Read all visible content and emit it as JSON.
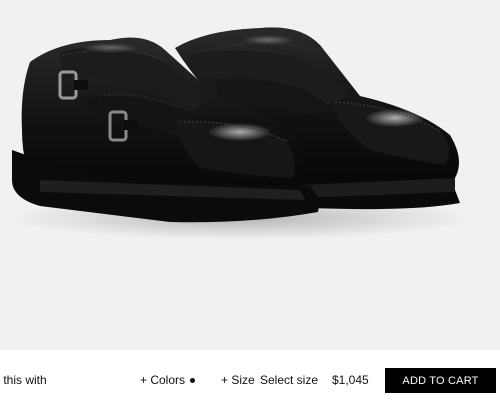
{
  "product": {
    "image_alt": "Black leather double monk strap brogue shoes"
  },
  "purchase_bar": {
    "pair_label": "r this with",
    "colors_label": "+ Colors",
    "selected_color": "#111111",
    "size_label": "+ Size",
    "size_select": "Select size",
    "price": "$1,045",
    "add_to_cart": "ADD TO CART"
  }
}
